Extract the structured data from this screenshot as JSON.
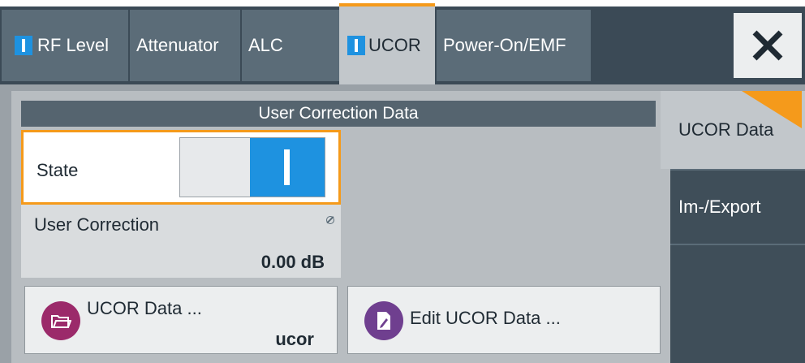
{
  "tabs": [
    {
      "label": "RF Level",
      "indicator": true
    },
    {
      "label": "Attenuator",
      "indicator": false
    },
    {
      "label": "ALC",
      "indicator": false
    },
    {
      "label": "UCOR",
      "indicator": true,
      "active": true
    },
    {
      "label": "Power-On/EMF",
      "indicator": false
    }
  ],
  "close_icon": "close-icon",
  "section": {
    "title": "User Correction Data"
  },
  "state": {
    "label": "State",
    "value": "on"
  },
  "user_correction": {
    "label": "User Correction",
    "value": "0.00 dB",
    "icon": "read-only-icon"
  },
  "buttons": {
    "ucor_data": {
      "title": "UCOR Data ...",
      "sub": "ucor",
      "icon": "folder-icon"
    },
    "edit_ucor": {
      "title": "Edit UCOR Data ...",
      "icon": "edit-document-icon"
    }
  },
  "side_tabs": [
    {
      "label": "UCOR Data",
      "active": true
    },
    {
      "label": "Im-/Export"
    }
  ],
  "colors": {
    "accent": "#f59a1b",
    "indicator": "#1e92e0",
    "header": "#55646f"
  }
}
